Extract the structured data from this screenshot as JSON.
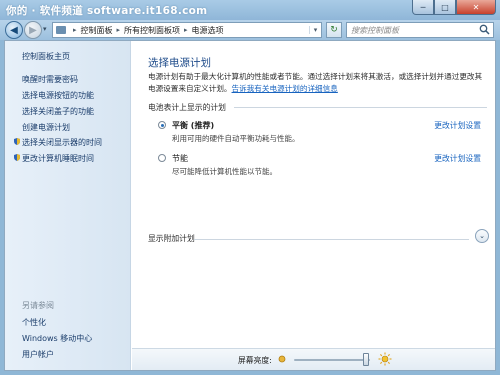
{
  "watermark": "你的 · 软件频道 software.it168.com",
  "window": {
    "min": "─",
    "max": "□",
    "close": "✕"
  },
  "nav": {
    "back": "◀",
    "forward": "▶",
    "dropdown": "▾",
    "breadcrumb": [
      "控制面板",
      "所有控制面板项",
      "电源选项"
    ],
    "breadcrumb_sep": "▸",
    "address_drop": "▾",
    "refresh": "↻",
    "search_placeholder": "搜索控制面板"
  },
  "sidebar": {
    "home": "控制面板主页",
    "items": [
      "唤醒时需要密码",
      "选择电源按钮的功能",
      "选择关闭盖子的功能",
      "创建电源计划",
      "选择关闭显示器的时间",
      "更改计算机睡眠时间"
    ],
    "see_also_label": "另请参阅",
    "see_also": [
      "个性化",
      "Windows 移动中心",
      "用户帐户"
    ]
  },
  "main": {
    "title": "选择电源计划",
    "desc_part1": "电源计划有助于最大化计算机的性能或者节能。通过选择计划来将其激活，或选择计划并通过更改其电源设置来自定义计划。",
    "desc_link": "告诉我有关电源计划的详细信息",
    "group_label": "电池表计上显示的计划",
    "plans": [
      {
        "name": "平衡 (推荐)",
        "sub": "利用可用的硬件自动平衡功耗与性能。",
        "selected": true,
        "link": "更改计划设置"
      },
      {
        "name": "节能",
        "sub": "尽可能降低计算机性能以节能。",
        "selected": false,
        "link": "更改计划设置"
      }
    ],
    "show_more": "显示附加计划",
    "chevron": "⌄"
  },
  "bottom": {
    "brightness_label": "屏幕亮度:",
    "brightness_fraction": 0.95
  },
  "colors": {
    "link": "#1763bf",
    "title": "#1e4b8a",
    "chrome": "#9cc0de"
  }
}
